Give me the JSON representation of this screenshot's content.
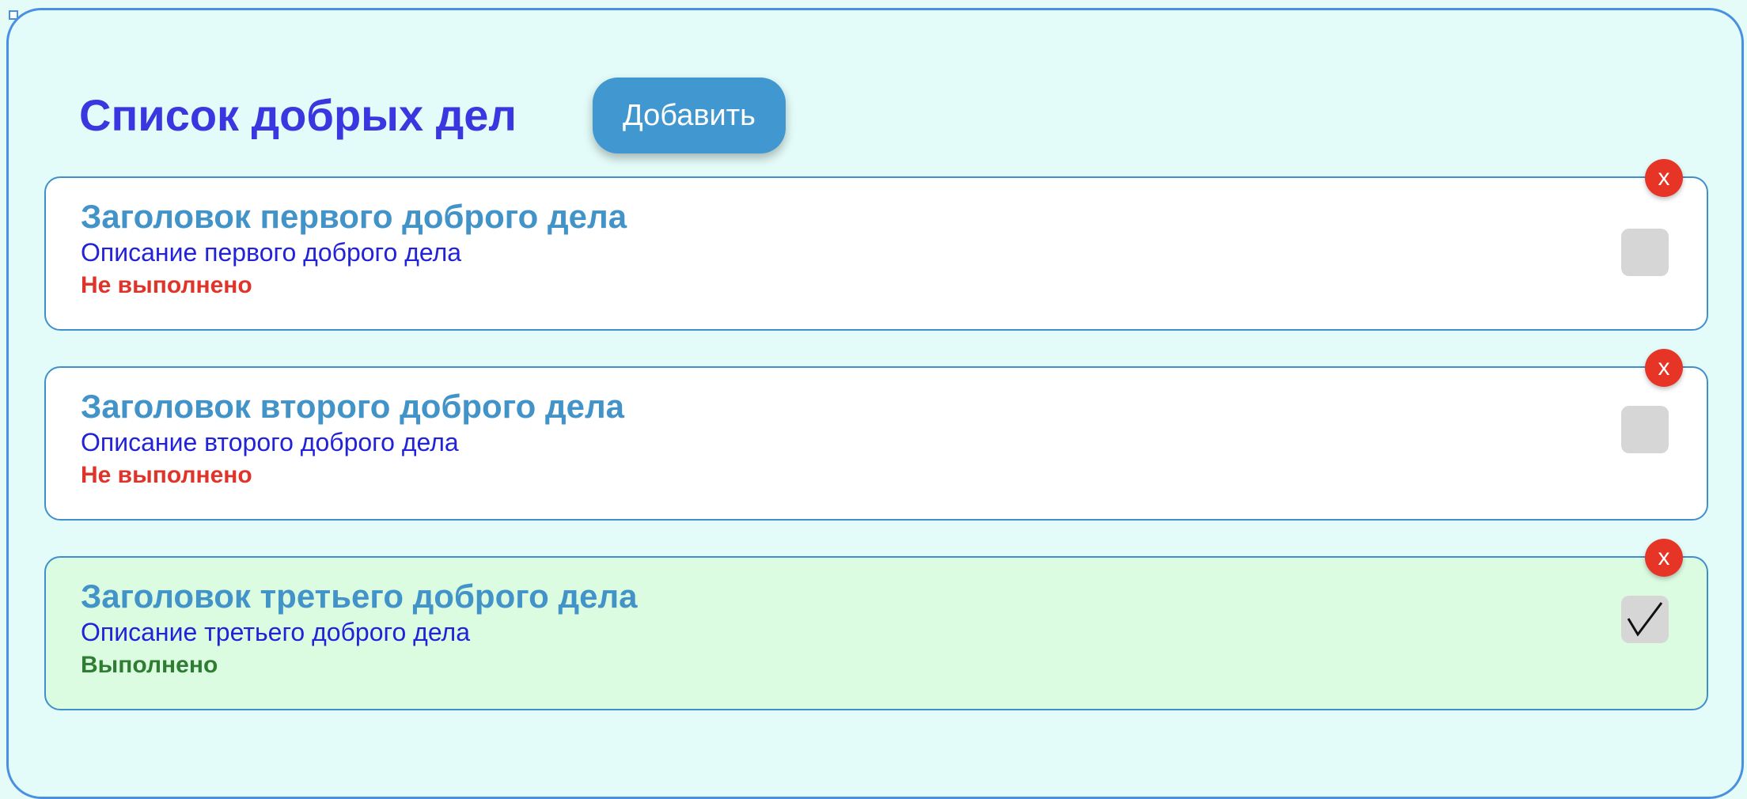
{
  "header": {
    "title": "Список добрых дел",
    "add_label": "Добавить"
  },
  "tasks": [
    {
      "title": "Заголовок первого доброго дела",
      "description": "Описание первого доброго дела",
      "status": "Не выполнено",
      "done": false,
      "delete_label": "x"
    },
    {
      "title": "Заголовок второго доброго дела",
      "description": "Описание второго доброго дела",
      "status": "Не выполнено",
      "done": false,
      "delete_label": "x"
    },
    {
      "title": "Заголовок третьего доброго дела",
      "description": "Описание третьего доброго дела",
      "status": "Выполнено",
      "done": true,
      "delete_label": "x"
    }
  ],
  "colors": {
    "background": "#e3fcf9",
    "frame_border": "#4a90e2",
    "title": "#3a36e0",
    "accent_button": "#4197d0",
    "task_title": "#4294c8",
    "task_desc": "#2222d8",
    "status_pending": "#e0342a",
    "status_done": "#2e7d32",
    "done_card_bg": "#dcfce2",
    "delete_button": "#e63427",
    "checkbox": "#d6d6d6"
  },
  "icons": {
    "delete": "close-icon",
    "checkbox_checked": "checkmark-icon"
  }
}
